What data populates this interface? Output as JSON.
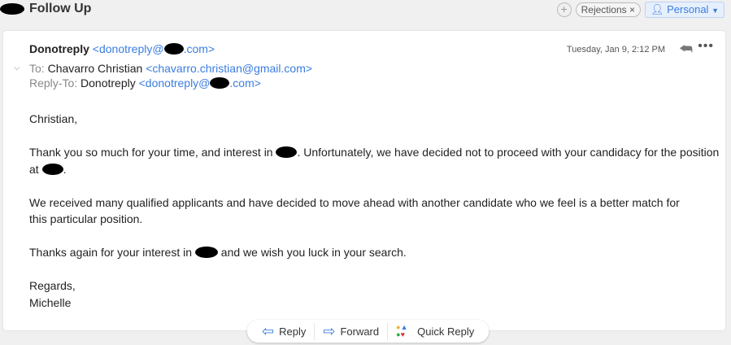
{
  "header": {
    "title": "Follow Up",
    "tags": [
      {
        "label": "Rejections",
        "remove": "×"
      }
    ],
    "add": "+",
    "account": {
      "label": "Personal",
      "icon": "person-icon"
    }
  },
  "email": {
    "from_name": "Donotreply",
    "from_email_pre": "<donotreply@",
    "from_email_post": ".com>",
    "date": "Tuesday, Jan 9, 2:12 PM",
    "to_label": "To:",
    "to_name": "Chavarro Christian",
    "to_email": "<chavarro.christian@gmail.com>",
    "replyto_label": "Reply-To:",
    "replyto_name": "Donotreply",
    "replyto_email_pre": "<donotreply@",
    "replyto_email_post": ".com>",
    "body": {
      "greeting": "Christian,",
      "p1a": "Thank you so much for your time, and interest in ",
      "p1b": ". Unfortunately, we have decided not to proceed with your candidacy for the position at ",
      "p1c": ".",
      "p2": "We received many qualified applicants and have decided to move ahead with another candidate who we feel is a better match for this particular position.",
      "p3a": "Thanks again for your interest in ",
      "p3b": " and we wish you luck in your search.",
      "closing": "Regards,",
      "signature": "Michelle"
    }
  },
  "actions": {
    "reply": "Reply",
    "forward": "Forward",
    "quick_reply": "Quick Reply"
  },
  "colors": {
    "accent": "#3b7de0"
  }
}
